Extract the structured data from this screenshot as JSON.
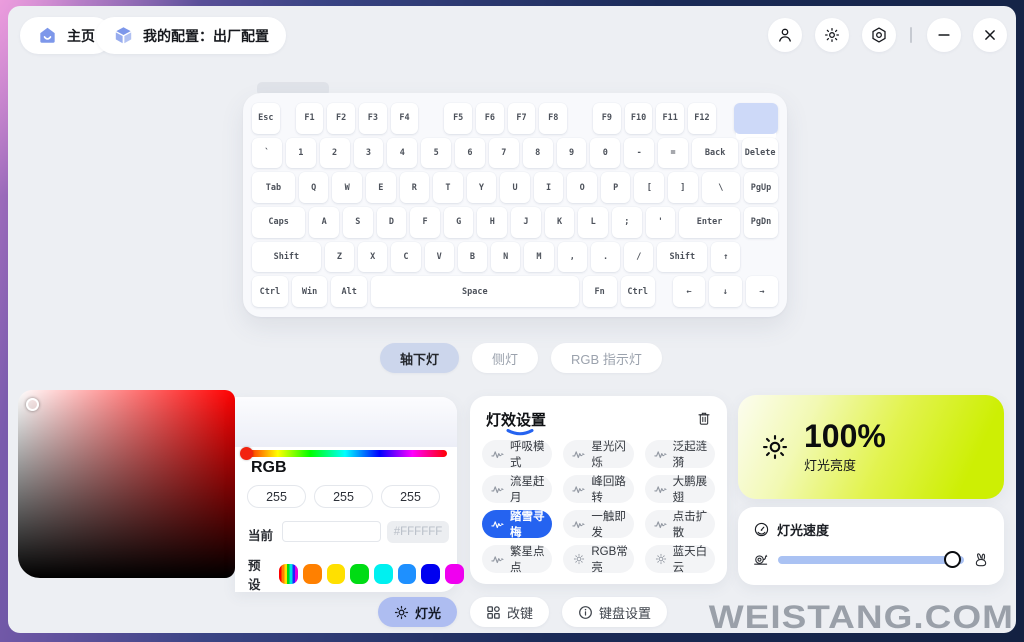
{
  "header": {
    "home_label": "主页",
    "config_label": "我的配置：出厂配置",
    "window_icons": [
      "user-icon",
      "brightness-icon",
      "settings-icon",
      "minimize-icon",
      "close-icon"
    ]
  },
  "keyboard": {
    "rows": [
      [
        {
          "l": "Esc",
          "w": 1
        },
        {
          "sp": 8
        },
        {
          "l": "F1",
          "w": 1
        },
        {
          "l": "F2",
          "w": 1
        },
        {
          "l": "F3",
          "w": 1
        },
        {
          "l": "F4",
          "w": 1
        },
        {
          "sp": 18
        },
        {
          "l": "F5",
          "w": 1
        },
        {
          "l": "F6",
          "w": 1
        },
        {
          "l": "F7",
          "w": 1
        },
        {
          "l": "F8",
          "w": 1
        },
        {
          "sp": 18
        },
        {
          "l": "F9",
          "w": 1
        },
        {
          "l": "F10",
          "w": 1
        },
        {
          "l": "F11",
          "w": 1
        },
        {
          "l": "F12",
          "w": 1
        },
        {
          "sp": 10
        },
        {
          "l": "",
          "w": 1.6,
          "v": "accent"
        }
      ],
      [
        {
          "l": "`",
          "w": 1
        },
        {
          "l": "1",
          "w": 1
        },
        {
          "l": "2",
          "w": 1
        },
        {
          "l": "3",
          "w": 1
        },
        {
          "l": "4",
          "w": 1
        },
        {
          "l": "5",
          "w": 1
        },
        {
          "l": "6",
          "w": 1
        },
        {
          "l": "7",
          "w": 1
        },
        {
          "l": "8",
          "w": 1
        },
        {
          "l": "9",
          "w": 1
        },
        {
          "l": "0",
          "w": 1
        },
        {
          "l": "-",
          "w": 1
        },
        {
          "l": "=",
          "w": 1
        },
        {
          "l": "Back",
          "w": 1.55
        },
        {
          "l": "Delete",
          "w": 1.2
        }
      ],
      [
        {
          "l": "Tab",
          "w": 1.45
        },
        {
          "l": "Q",
          "w": 1
        },
        {
          "l": "W",
          "w": 1
        },
        {
          "l": "E",
          "w": 1
        },
        {
          "l": "R",
          "w": 1
        },
        {
          "l": "T",
          "w": 1
        },
        {
          "l": "Y",
          "w": 1
        },
        {
          "l": "U",
          "w": 1
        },
        {
          "l": "I",
          "w": 1
        },
        {
          "l": "O",
          "w": 1
        },
        {
          "l": "P",
          "w": 1
        },
        {
          "l": "[",
          "w": 1
        },
        {
          "l": "]",
          "w": 1
        },
        {
          "l": "\\",
          "w": 1.3
        },
        {
          "l": "PgUp",
          "w": 1.15
        }
      ],
      [
        {
          "l": "Caps",
          "w": 1.8
        },
        {
          "l": "A",
          "w": 1
        },
        {
          "l": "S",
          "w": 1
        },
        {
          "l": "D",
          "w": 1
        },
        {
          "l": "F",
          "w": 1
        },
        {
          "l": "G",
          "w": 1
        },
        {
          "l": "H",
          "w": 1
        },
        {
          "l": "J",
          "w": 1
        },
        {
          "l": "K",
          "w": 1
        },
        {
          "l": "L",
          "w": 1
        },
        {
          "l": ";",
          "w": 1
        },
        {
          "l": "'",
          "w": 1
        },
        {
          "l": "Enter",
          "w": 2.05
        },
        {
          "l": "PgDn",
          "w": 1.15
        }
      ],
      [
        {
          "l": "Shift",
          "w": 2.35
        },
        {
          "l": "Z",
          "w": 1
        },
        {
          "l": "X",
          "w": 1
        },
        {
          "l": "C",
          "w": 1
        },
        {
          "l": "V",
          "w": 1
        },
        {
          "l": "B",
          "w": 1
        },
        {
          "l": "N",
          "w": 1
        },
        {
          "l": "M",
          "w": 1
        },
        {
          "l": ",",
          "w": 1
        },
        {
          "l": ".",
          "w": 1
        },
        {
          "l": "/",
          "w": 1
        },
        {
          "l": "Shift",
          "w": 1.7
        },
        {
          "l": "↑",
          "w": 1
        },
        {
          "l": "",
          "w": 1.15,
          "v": "ghost"
        }
      ],
      [
        {
          "l": "Ctrl",
          "w": 1.1
        },
        {
          "l": "Win",
          "w": 1.1
        },
        {
          "l": "Alt",
          "w": 1.1
        },
        {
          "l": "Space",
          "w": 6.4
        },
        {
          "l": "Fn",
          "w": 1.05
        },
        {
          "l": "Ctrl",
          "w": 1.05
        },
        {
          "sp": 10
        },
        {
          "l": "←",
          "w": 1
        },
        {
          "l": "↓",
          "w": 1
        },
        {
          "l": "→",
          "w": 1
        }
      ]
    ]
  },
  "light_tabs": [
    {
      "label": "轴下灯",
      "active": true
    },
    {
      "label": "侧灯",
      "active": false
    },
    {
      "label": "RGB 指示灯",
      "active": false
    }
  ],
  "color_picker": {
    "rgb_label": "RGB",
    "r": "255",
    "g": "255",
    "b": "255",
    "current_label": "当前",
    "current_value": "",
    "hex_value": "#FFFFFF",
    "preset_label": "预设",
    "presets": [
      "rainbow",
      "#FF8000",
      "#FFE000",
      "#00DC14",
      "#00F0F0",
      "#1E90FF",
      "#0000F0",
      "#F000F0"
    ],
    "hue_thumb_color": "#F2230F"
  },
  "effects": {
    "title": "灯效设置",
    "accent_color": "#2563F0",
    "items": [
      {
        "label": "呼吸模式",
        "icon": "wave-icon",
        "active": false
      },
      {
        "label": "星光闪烁",
        "icon": "wave-icon",
        "active": false
      },
      {
        "label": "泛起涟漪",
        "icon": "wave-icon",
        "active": false
      },
      {
        "label": "流星赶月",
        "icon": "wave-icon",
        "active": false
      },
      {
        "label": "峰回路转",
        "icon": "wave-icon",
        "active": false
      },
      {
        "label": "大鹏展翅",
        "icon": "wave-icon",
        "active": false
      },
      {
        "label": "踏雪寻梅",
        "icon": "wave-icon",
        "active": true
      },
      {
        "label": "一触即发",
        "icon": "wave-icon",
        "active": false
      },
      {
        "label": "点击扩散",
        "icon": "wave-icon",
        "active": false
      },
      {
        "label": "繁星点点",
        "icon": "wave-icon",
        "active": false
      },
      {
        "label": "RGB常亮",
        "icon": "bulb-icon",
        "active": false
      },
      {
        "label": "蓝天白云",
        "icon": "bulb-icon",
        "active": false
      }
    ]
  },
  "brightness": {
    "value": "100%",
    "label": "灯光亮度"
  },
  "speed": {
    "label": "灯光速度",
    "percent": 97
  },
  "bottom_nav": [
    {
      "label": "灯光",
      "icon": "sun-icon",
      "active": true
    },
    {
      "label": "改键",
      "icon": "grid-icon",
      "active": false
    },
    {
      "label": "键盘设置",
      "icon": "info-icon",
      "active": false
    }
  ],
  "watermark": "WEISTANG.COM"
}
